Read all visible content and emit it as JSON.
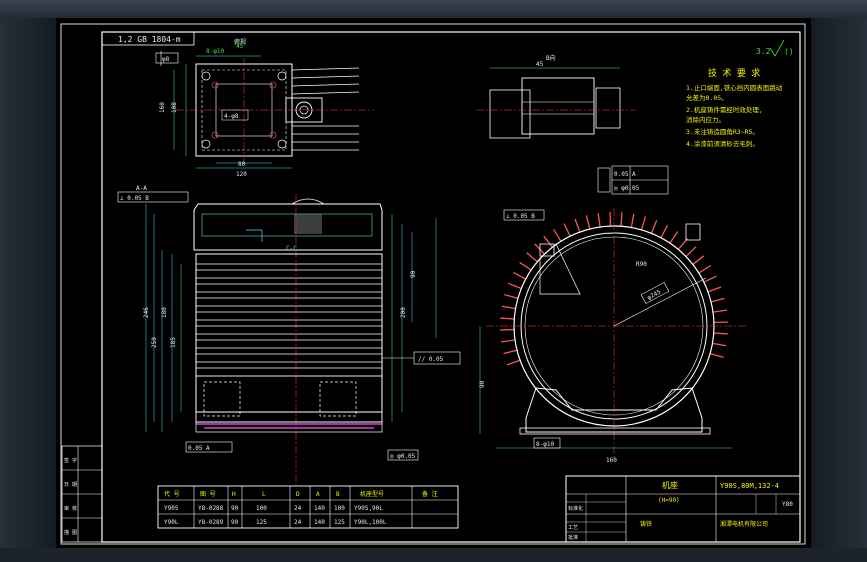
{
  "title_block": {
    "drawing_number": "Y90S,80M,132-4",
    "part_name": "机座",
    "part_spec": "(H=90)",
    "material": "铸铁",
    "sheet_code": "Y80",
    "label_standard": "标准化",
    "label_process": "工艺",
    "label_approve": "批准",
    "company": "湘潭电机有限公司"
  },
  "corner_box": {
    "text": "1,2 GB 1804-m"
  },
  "tech_requirements": {
    "title": "技 术 要 求",
    "lines": [
      "1.止口端面,铁心挡内圆表面跳动",
      "允差为0.05。",
      "2.机座铸件需经时效处理,",
      "消除内应力。",
      "3.未注铸造圆角R3~R5。",
      "4.涂漆前须清砂去毛刺。"
    ]
  },
  "roughness_mark": {
    "text": "3.2"
  },
  "parts_table": {
    "headers": [
      "代 号",
      "图 号",
      "H",
      "L",
      "D",
      "A",
      "B",
      "机座型号",
      "备 注"
    ],
    "rows": [
      [
        "Y90S",
        "Y8-0288",
        "90",
        "100",
        "24",
        "140",
        "100",
        "Y90S,90L",
        ""
      ],
      [
        "Y90L",
        "Y8-0289",
        "90",
        "125",
        "24",
        "140",
        "125",
        "Y90L,100L",
        ""
      ]
    ]
  },
  "left_strip": {
    "labels": [
      "签 字",
      "日 期",
      "审 核",
      "描 图"
    ]
  },
  "view_labels": {
    "top_view": "俯视",
    "section_view": "A-A",
    "end_view": "B向",
    "cut": "C-C"
  },
  "dims": {
    "d1": "φ8",
    "d2": "45",
    "d3": "80",
    "d4": "108",
    "d5": "120",
    "d6": "160",
    "d7": "246",
    "d8": "250",
    "d9": "180",
    "d10": "185",
    "d11": "200",
    "d12": "90",
    "d13": "8-φ10",
    "d14": "φ245",
    "d15": "R90",
    "d16": "4-φ8"
  },
  "gdt": {
    "g1": "0.05 A",
    "g2": "// 0.05",
    "g3": "◎ φ0.05",
    "g4": "⊥ 0.05 B"
  }
}
